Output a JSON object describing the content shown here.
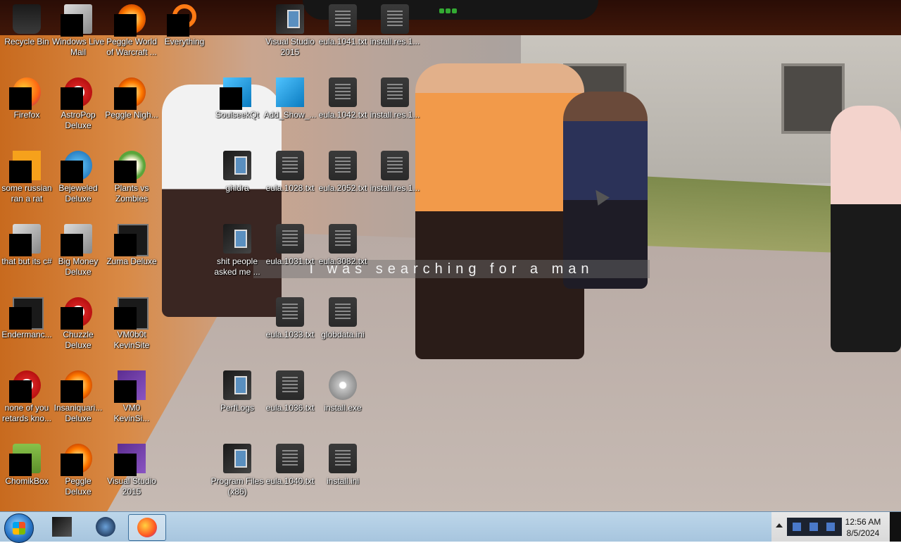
{
  "desktop": {
    "icons": [
      {
        "label": "Recycle Bin",
        "icon": "recycle-bin-icon"
      },
      {
        "label": "Windows Live Mail",
        "icon": "mail-icon"
      },
      {
        "label": "Peggle World of Warcraft ...",
        "icon": "peggle-icon"
      },
      {
        "label": "Everything",
        "icon": "search-ring-icon"
      },
      {
        "label": "Visual Studio 2015",
        "icon": "folder-icon"
      },
      {
        "label": "eula.1041.txt",
        "icon": "text-file-icon"
      },
      {
        "label": "install.res.1...",
        "icon": "resource-file-icon"
      },
      {
        "label": "Firefox",
        "icon": "firefox-icon"
      },
      {
        "label": "AstroPop Deluxe",
        "icon": "astropop-icon"
      },
      {
        "label": "Peggle Nigh...",
        "icon": "peggle-nights-icon"
      },
      {
        "label": "SoulseekQt",
        "icon": "soulseek-icon"
      },
      {
        "label": "Add_Show_...",
        "icon": "registry-file-icon"
      },
      {
        "label": "eula.1042.txt",
        "icon": "text-file-icon"
      },
      {
        "label": "install.res.1...",
        "icon": "resource-file-icon"
      },
      {
        "label": "some russian ran a rat",
        "icon": "ie-icon"
      },
      {
        "label": "Bejeweled Deluxe",
        "icon": "bejeweled-icon"
      },
      {
        "label": "Plants vs Zombies",
        "icon": "plants-vs-zombies-icon"
      },
      {
        "label": "ghidra",
        "icon": "folder-icon"
      },
      {
        "label": "eula.1028.txt",
        "icon": "text-file-icon"
      },
      {
        "label": "eula.2052.txt",
        "icon": "text-file-icon"
      },
      {
        "label": "install.res.1...",
        "icon": "resource-file-icon"
      },
      {
        "label": "that but its c#",
        "icon": "shortcut-icon"
      },
      {
        "label": "Big Money Deluxe",
        "icon": "big-money-icon"
      },
      {
        "label": "Zuma Deluxe",
        "icon": "zuma-icon"
      },
      {
        "label": "shit people asked me ...",
        "icon": "folder-icon"
      },
      {
        "label": "eula.1031.txt",
        "icon": "text-file-icon"
      },
      {
        "label": "eula.3082.txt",
        "icon": "text-file-icon"
      },
      {
        "label": "Endermanc...",
        "icon": "monitor-icon"
      },
      {
        "label": "Chuzzle Deluxe",
        "icon": "chuzzle-icon"
      },
      {
        "label": "VM0b0t KevinSite",
        "icon": "monitor-icon"
      },
      {
        "label": "eula.1033.txt",
        "icon": "text-file-icon"
      },
      {
        "label": "globdata.ini",
        "icon": "ini-file-icon"
      },
      {
        "label": "none of you retards kno...",
        "icon": "red-circle-icon"
      },
      {
        "label": "Insaniquari... Deluxe",
        "icon": "insaniquarium-icon"
      },
      {
        "label": "VM0 KevinSi...",
        "icon": "purple-app-icon"
      },
      {
        "label": "PerfLogs",
        "icon": "folder-icon"
      },
      {
        "label": "eula.1036.txt",
        "icon": "text-file-icon"
      },
      {
        "label": "install.exe",
        "icon": "installer-icon"
      },
      {
        "label": "ChomikBox",
        "icon": "chomikbox-icon"
      },
      {
        "label": "Peggle Deluxe",
        "icon": "peggle-icon"
      },
      {
        "label": "Visual Studio 2015",
        "icon": "visual-studio-icon"
      },
      {
        "label": "Program Files (x86)",
        "icon": "folder-icon"
      },
      {
        "label": "eula.1040.txt",
        "icon": "text-file-icon"
      },
      {
        "label": "install.ini",
        "icon": "ini-file-icon"
      }
    ],
    "subtitle": "I was searching for a man"
  },
  "taskbar": {
    "pinned": [
      {
        "name": "file-explorer",
        "icon": "explorer-icon"
      },
      {
        "name": "steam",
        "icon": "steam-icon"
      },
      {
        "name": "firefox",
        "icon": "firefox-icon",
        "active": true
      }
    ],
    "clock": {
      "time": "12:56 AM",
      "date": "8/5/2024"
    }
  }
}
